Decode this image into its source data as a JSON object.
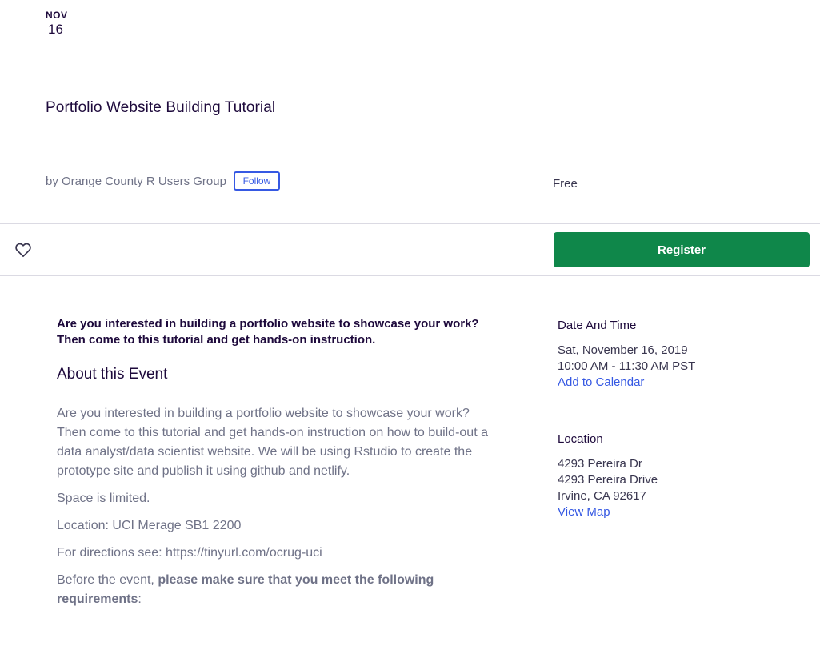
{
  "event": {
    "month": "NOV",
    "day": "16",
    "title": "Portfolio Website Building Tutorial",
    "organizer": "by Orange County R Users Group",
    "follow_label": "Follow",
    "price": "Free"
  },
  "actions": {
    "like_icon": "heart-outline-icon",
    "register_label": "Register",
    "register_color": "#0f874a"
  },
  "main": {
    "summary_line1": "Are you interested in building a portfolio website to showcase your work?",
    "summary_line2": "Then come to this tutorial and get hands-on instruction.",
    "about_heading": "About this Event",
    "paragraph1": "Are you interested in building a portfolio website to showcase your work? Then come to this tutorial and get hands-on instruction on how to build-out a data analyst/data scientist website. We will be using Rstudio to create the prototype site and publish it using github and netlify.",
    "paragraph2": "Space is limited.",
    "paragraph3": "Location: UCI Merage SB1 2200",
    "paragraph4": "For directions see: https://tinyurl.com/ocrug-uci",
    "paragraph5_prefix": "Before the event, ",
    "paragraph5_bold": "please make sure that you meet the following requirements",
    "paragraph5_suffix": ":"
  },
  "sidebar": {
    "datetime_heading": "Date And Time",
    "date": "Sat, November 16, 2019",
    "time": "10:00 AM - 11:30 AM PST",
    "add_calendar": "Add to Calendar",
    "location_heading": "Location",
    "address1": "4293 Pereira Dr",
    "address2": "4293 Pereira Drive",
    "address3": "Irvine, CA 92617",
    "view_map": "View Map"
  },
  "colors": {
    "link": "#3659e3",
    "title": "#1e0a3c",
    "muted": "#6f7287"
  }
}
